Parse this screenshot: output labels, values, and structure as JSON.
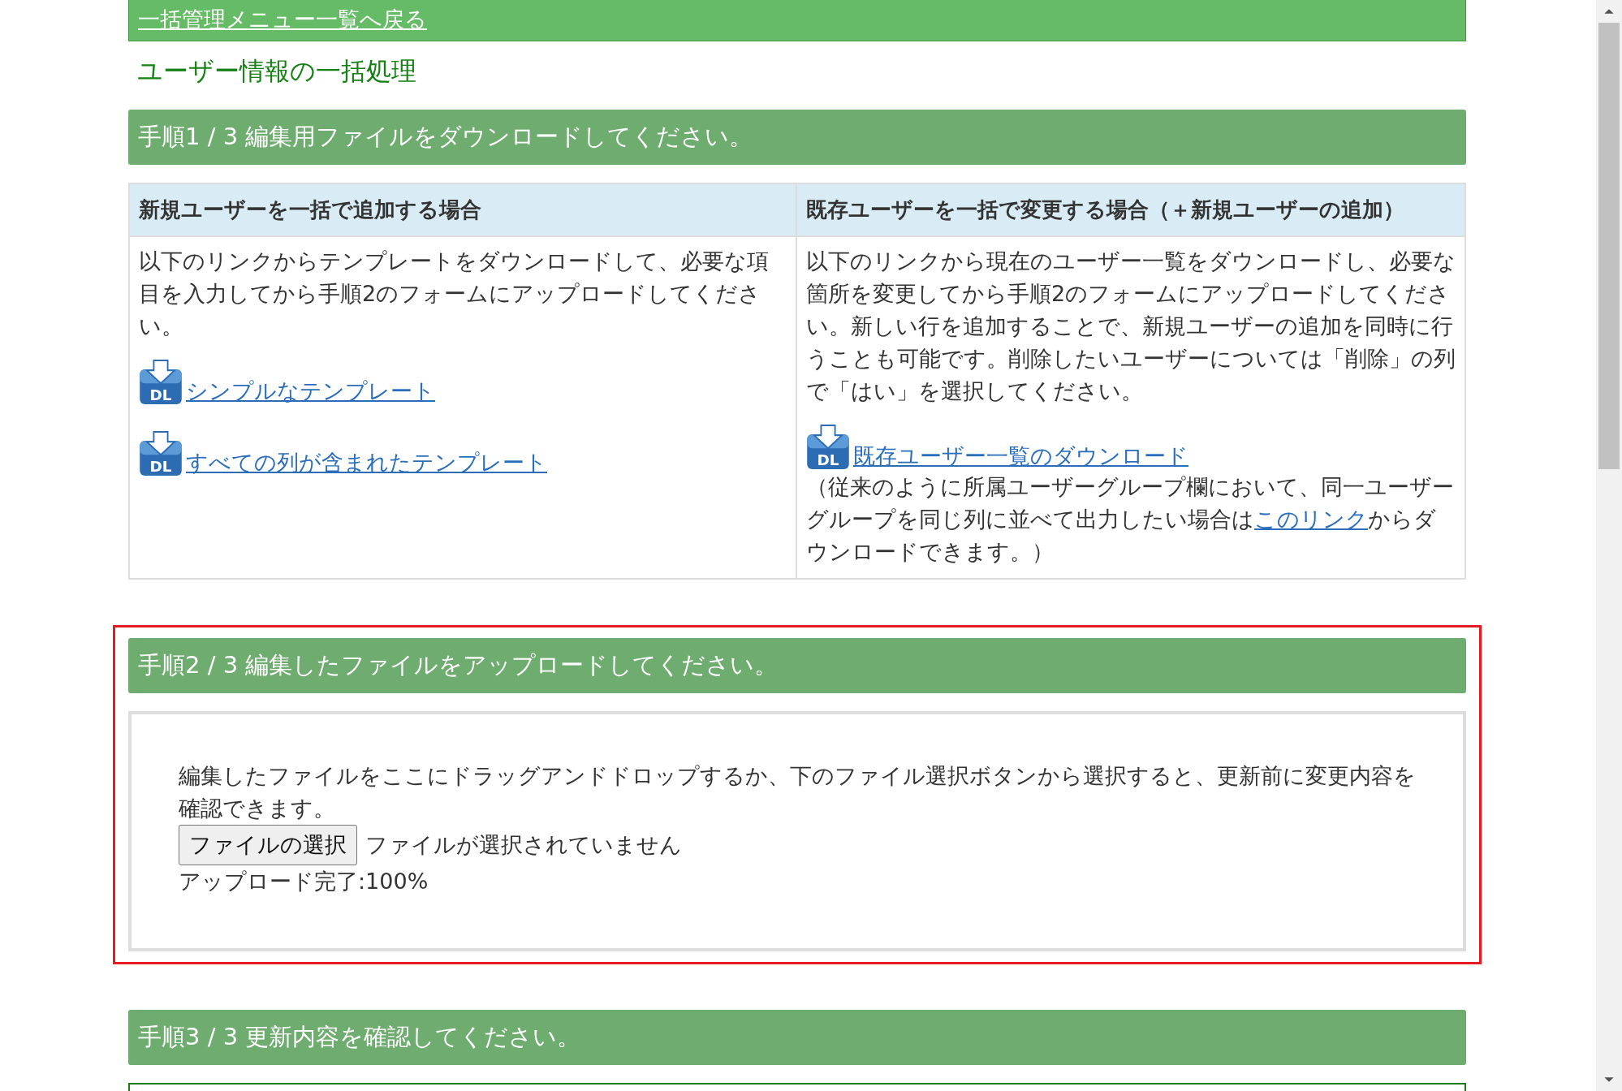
{
  "back_link": "一括管理メニュー一覧へ戻る",
  "page_title": "ユーザー情報の一括処理",
  "steps": [
    {
      "kind": "download",
      "header": "手順1 / 3 編集用ファイルをダウンロードしてください。",
      "highlighted": false,
      "columns": [
        {
          "heading": "新規ユーザーを一括で追加する場合",
          "description": "以下のリンクからテンプレートをダウンロードして、必要な項目を入力してから手順2のフォームにアップロードしてください。",
          "links": [
            {
              "icon_text": "DL",
              "label": "シンプルなテンプレート"
            },
            {
              "icon_text": "DL",
              "label": "すべての列が含まれたテンプレート"
            }
          ]
        },
        {
          "heading": "既存ユーザーを一括で変更する場合（＋新規ユーザーの追加）",
          "description": "以下のリンクから現在のユーザー一覧をダウンロードし、必要な箇所を変更してから手順2のフォームにアップロードしてください。新しい行を追加することで、新規ユーザーの追加を同時に行うことも可能です。削除したいユーザーについては「削除」の列で「はい」を選択してください。",
          "links": [
            {
              "icon_text": "DL",
              "label": "既存ユーザー一覧のダウンロード"
            }
          ],
          "note": {
            "before": "（従来のように所属ユーザーグループ欄において、同一ユーザーグループを同じ列に並べて出力したい場合は",
            "link": "このリンク",
            "after": "からダウンロードできます。）"
          }
        }
      ]
    },
    {
      "kind": "upload",
      "header": "手順2 / 3 編集したファイルをアップロードしてください。",
      "highlighted": true,
      "instructions": "編集したファイルをここにドラッグアンドドロップするか、下のファイル選択ボタンから選択すると、更新前に変更内容を確認できます。",
      "file_button": "ファイルの選択",
      "file_status": "ファイルが選択されていません",
      "progress_text": "アップロード完了:100%"
    },
    {
      "kind": "confirm",
      "header": "手順3 / 3 更新内容を確認してください。",
      "highlighted": false
    }
  ]
}
